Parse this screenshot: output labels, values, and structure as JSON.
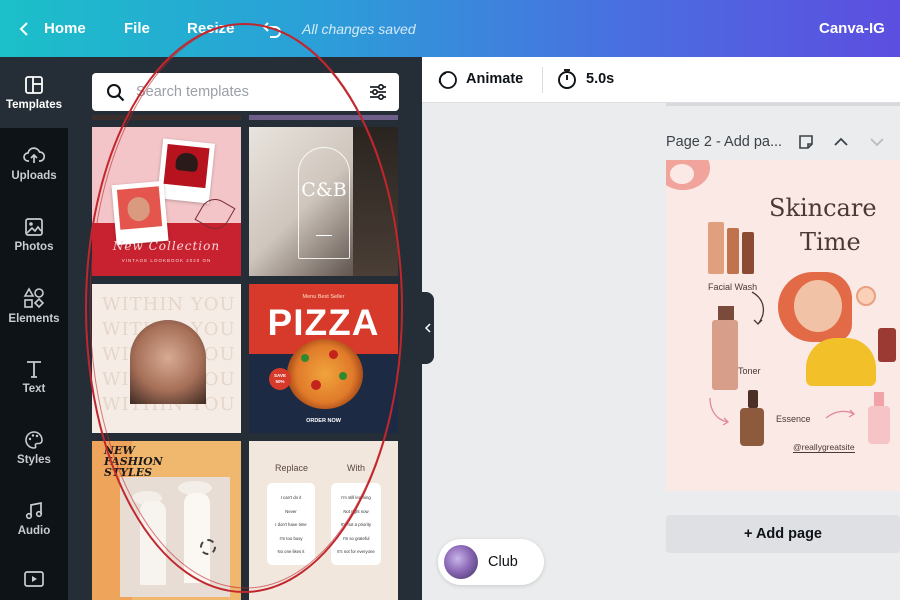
{
  "topbar": {
    "home_label": "Home",
    "file_label": "File",
    "resize_label": "Resize",
    "saved_status": "All changes saved",
    "project_title": "Canva-IG",
    "back_icon": "chevron-left-icon",
    "undo_icon": "undo-icon"
  },
  "rail": {
    "items": [
      {
        "label": "Templates",
        "icon": "templates-icon"
      },
      {
        "label": "Uploads",
        "icon": "upload-cloud-icon"
      },
      {
        "label": "Photos",
        "icon": "photo-icon"
      },
      {
        "label": "Elements",
        "icon": "shapes-icon"
      },
      {
        "label": "Text",
        "icon": "text-icon"
      },
      {
        "label": "Styles",
        "icon": "palette-icon"
      },
      {
        "label": "Audio",
        "icon": "music-note-icon"
      },
      {
        "label": "",
        "icon": "video-icon"
      }
    ]
  },
  "search": {
    "placeholder": "Search templates"
  },
  "templates": {
    "t1_title": "New Collection",
    "t1_sub": "VINTAGE LOOKBOOK 2020 ON",
    "t2_monogram": "C&B",
    "t3_text": "WITHIN YOU",
    "t4_top": "Menu Best Seller",
    "t4_title": "PIZZA",
    "t4_badge_1": "SAVE",
    "t4_badge_2": "50%",
    "t4_cta": "ORDER NOW",
    "t5_title_1": "NEW",
    "t5_title_2": "FASHION",
    "t5_title_3": "STYLES",
    "t6_col1": "Replace",
    "t6_col2": "With",
    "t6_left": [
      "I can't do it",
      "Never",
      "I don't have time",
      "I'm too busy",
      "No one likes it"
    ],
    "t6_right": [
      "I'm still learning",
      "Not right now",
      "It's not a priority",
      "I'm so grateful",
      "It's not for everyone"
    ]
  },
  "editor": {
    "animate_label": "Animate",
    "duration": "5.0s",
    "page_label": "Page 2 - Add pa...",
    "add_page_label": "+ Add page"
  },
  "design": {
    "title_1": "Skincare",
    "title_2": "Time",
    "label_wash": "Facial Wash",
    "label_toner": "Toner",
    "label_essence": "Essence",
    "handle": "@reallygreatsite"
  },
  "club": {
    "label": "Club"
  },
  "colors": {
    "topbar_start": "#1bc0c9",
    "topbar_end": "#5c4ee0",
    "rail_bg": "#0e1318",
    "panel_bg": "#252d36",
    "annotation_red": "#c1272d"
  }
}
